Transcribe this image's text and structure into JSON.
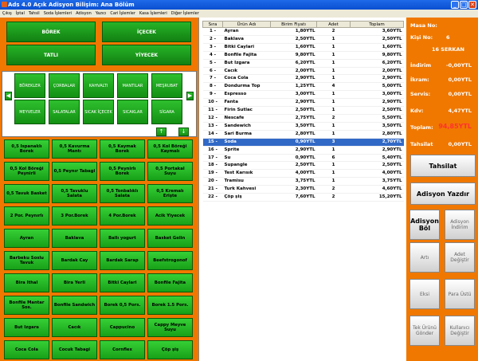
{
  "window": {
    "title": "Ads 4.0 Açık Adisyon Bilişim: Ana Bölüm",
    "min": "_",
    "max": "□",
    "close": "✕"
  },
  "menu": [
    "Çıkış",
    "İptal",
    "Tahsil",
    "Soda İşlemleri",
    "Adisyon",
    "Yazıcı",
    "Cari İşlemler",
    "Kasa İşlemleri",
    "Diğer İşlemler"
  ],
  "categories": [
    "BÖREK",
    "İÇECEK",
    "TATLI",
    "YİYECEK"
  ],
  "subcategories": [
    "BÖREKLER",
    "ÇORBALAR",
    "KAHVALTI",
    "MANTILAR",
    "MEŞRUBAT",
    "MEYVELER",
    "SALATALAR",
    "SICAK İÇECEK",
    "SICAKLAR",
    "SİGARA"
  ],
  "arrows": {
    "left": "◀",
    "right": "▶",
    "up": "↑",
    "down": "↓"
  },
  "products": [
    "0,5 Ispanaklı Borek",
    "0,5 Kavurma Mantı",
    "0,5 Kaymak Borek",
    "0,5 Kol Böreği Kaymalı",
    "0,5 Kol Böreği Peynirli",
    "0,5 Peynır Tabagi",
    "0,5 Peynirlı Borek",
    "0,5 Portakal Suyu",
    "0,5 Tavuk Basket",
    "0,5 Tavuklu Salata",
    "0,5 Tonbalıklı Salata",
    "0,5 Kremalı Erişte",
    "2 Por. Peynırlı",
    "3 Por.Borek",
    "4 Por.Borek",
    "Acik Yiyecek",
    "Ayran",
    "Baklava",
    "Ballı yogurt",
    "Basket Gelin",
    "Barbeku Soslu Tavuk",
    "Bardak Cay",
    "Bardak Sarap",
    "Beefstrogonof",
    "Bira Ithal",
    "Bira Yerli",
    "Bitki Caylari",
    "Bonfile Fajita",
    "Bonfile Mantar Sos.",
    "Bonfile Sandwich",
    "Borek 0,5 Pors.",
    "Borek 1.5 Pors.",
    "But Izgara",
    "Cacık",
    "Cappucino",
    "Cappy Meyve Suyu",
    "Coca Cola",
    "Cocuk Tabagi",
    "Cornflex",
    "Çöp şiş"
  ],
  "order_table": {
    "headers": [
      "Sıra",
      "Ürün Adı",
      "Birim Fiyatı",
      "Adet",
      "Toplam"
    ],
    "rows": [
      [
        "1 -",
        "Ayran",
        "1,80YTL",
        "2",
        "3,60YTL"
      ],
      [
        "2 -",
        "Baklava",
        "2,50YTL",
        "1",
        "2,50YTL"
      ],
      [
        "3 -",
        "Bitki Caylari",
        "1,60YTL",
        "1",
        "1,60YTL"
      ],
      [
        "4 -",
        "Bonfile Fajita",
        "9,80YTL",
        "1",
        "9,80YTL"
      ],
      [
        "5 -",
        "But Izgara",
        "6,20YTL",
        "1",
        "6,20YTL"
      ],
      [
        "6 -",
        "Cacık",
        "2,00YTL",
        "1",
        "2,00YTL"
      ],
      [
        "7 -",
        "Coca Cola",
        "2,90YTL",
        "1",
        "2,90YTL"
      ],
      [
        "8 -",
        "Dondurma Top",
        "1,25YTL",
        "4",
        "5,00YTL"
      ],
      [
        "9 -",
        "Espresso",
        "3,00YTL",
        "1",
        "3,00YTL"
      ],
      [
        "10 -",
        "Fanta",
        "2,90YTL",
        "1",
        "2,90YTL"
      ],
      [
        "11 -",
        "Firin Sutlac",
        "2,50YTL",
        "1",
        "2,50YTL"
      ],
      [
        "12 -",
        "Nescafe",
        "2,75YTL",
        "2",
        "5,50YTL"
      ],
      [
        "13 -",
        "Sandewich",
        "3,50YTL",
        "1",
        "3,50YTL"
      ],
      [
        "14 -",
        "Sari Burma",
        "2,80YTL",
        "1",
        "2,80YTL"
      ],
      [
        "15 -",
        "Soda",
        "0,90YTL",
        "3",
        "2,70YTL"
      ],
      [
        "16 -",
        "Sprite",
        "2,90YTL",
        "1",
        "2,90YTL"
      ],
      [
        "17 -",
        "Su",
        "0,90YTL",
        "6",
        "5,40YTL"
      ],
      [
        "18 -",
        "Supangle",
        "2,50YTL",
        "1",
        "2,50YTL"
      ],
      [
        "19 -",
        "Test Karısık",
        "4,00YTL",
        "1",
        "4,00YTL"
      ],
      [
        "20 -",
        "Tramisu",
        "3,75YTL",
        "1",
        "3,75YTL"
      ],
      [
        "21 -",
        "Turk Kahvesi",
        "2,30YTL",
        "2",
        "4,60YTL"
      ],
      [
        "22 -",
        "Çöp şiş",
        "7,60YTL",
        "2",
        "15,20YTL"
      ]
    ],
    "selected_row": 14
  },
  "summary": {
    "masa_label": "Masa No:",
    "masa_value": "",
    "kisi_label": "Kişi No:",
    "kisi_value": "6",
    "table_name": "16 SERKAN",
    "indirim_label": "İndirim",
    "indirim_value": "-0,00YTL",
    "ikram_label": "İkram:",
    "ikram_value": "0,00YTL",
    "servis_label": "Servis:",
    "servis_value": "0,00YTL",
    "kdv_label": "Kdv:",
    "kdv_value": "4,47YTL",
    "toplam_label": "Toplam:",
    "toplam_value": "94,85YTL",
    "tahsilat_label": "Tahsilat",
    "tahsilat_value": "0,00YTL"
  },
  "actions": {
    "tahsilat": "Tahsilat",
    "yazdir": "Adisyon Yazdır",
    "bol": "Adisyon Böl",
    "indirim": "Adisyon İndirim",
    "arti": "Artı",
    "adet": "Adet Değiştir",
    "eksi": "Eksi",
    "para": "Para Üstü",
    "tek": "Tek Ürünü Gönder",
    "kullanici": "Kullanıcı Değiştir"
  },
  "colors": {
    "panel": "#f07800",
    "button": "#18a018",
    "selected_row": "#3169c6",
    "total": "#ff3030"
  }
}
